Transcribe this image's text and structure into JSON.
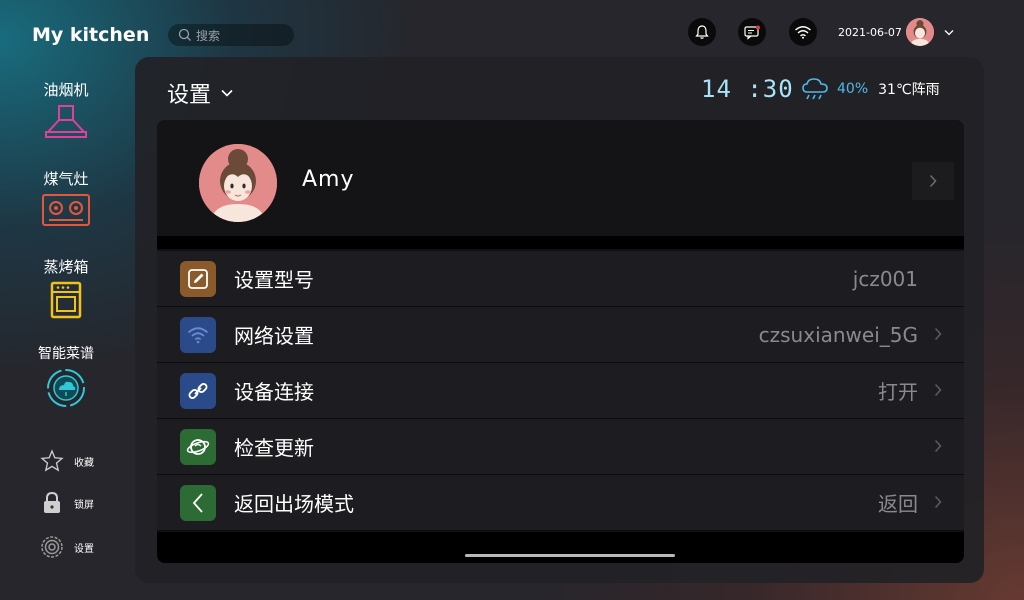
{
  "app": {
    "brand": "My kitchen"
  },
  "search": {
    "placeholder": "搜索"
  },
  "header": {
    "date": "2021-06-07"
  },
  "sidebar": {
    "items": [
      {
        "label": "油烟机",
        "icon": "range-hood-icon",
        "color": "#e0409a"
      },
      {
        "label": "煤气灶",
        "icon": "gas-stove-icon",
        "color": "#e8553a"
      },
      {
        "label": "蒸烤箱",
        "icon": "oven-icon",
        "color": "#f2c21a"
      },
      {
        "label": "智能菜谱",
        "icon": "smart-recipe-icon",
        "color": "#2fc8d8"
      }
    ],
    "small_items": [
      {
        "label": "收藏",
        "icon": "star-icon"
      },
      {
        "label": "锁屏",
        "icon": "lock-icon"
      },
      {
        "label": "设置",
        "icon": "gear-icon"
      }
    ]
  },
  "panel": {
    "title": "设置",
    "clock": "14 :30",
    "weather": {
      "humidity": "40%",
      "desc": "31℃阵雨",
      "icon": "rain-cloud-icon"
    }
  },
  "profile": {
    "name": "Amy"
  },
  "settings": [
    {
      "label": "设置型号",
      "value": "jcz001",
      "icon": "edit-icon",
      "icon_color": "#8a5a2a",
      "chevron": false
    },
    {
      "label": "网络设置",
      "value": "czsuxianwei_5G",
      "icon": "wifi-icon",
      "icon_color": "#2a4a8a",
      "chevron": true
    },
    {
      "label": "设备连接",
      "value": "打开",
      "icon": "link-icon",
      "icon_color": "#2a4a8a",
      "chevron": true
    },
    {
      "label": "检查更新",
      "value": "",
      "icon": "update-icon",
      "icon_color": "#2d6b34",
      "chevron": true
    },
    {
      "label": "返回出场模式",
      "value": "返回",
      "icon": "back-icon",
      "icon_color": "#2d6b34",
      "chevron": true
    }
  ]
}
